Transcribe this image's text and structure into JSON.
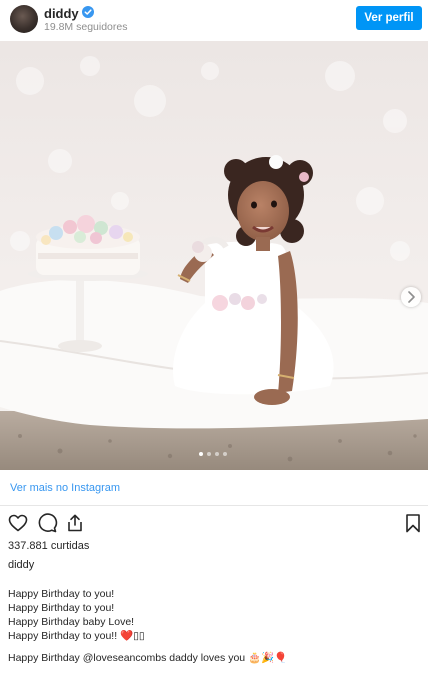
{
  "header": {
    "username": "diddy",
    "followers": "19.8M seguidores",
    "view_profile_label": "Ver perfil"
  },
  "carousel": {
    "slides": 4,
    "current": 1
  },
  "more_link": "Ver mais no Instagram",
  "likes": "337.881 curtidas",
  "caption": {
    "username": "diddy",
    "lines": [
      "Happy Birthday to you!",
      "Happy Birthday to you!",
      "Happy Birthday baby Love!",
      "Happy Birthday to you!! ❤️▯▯",
      "",
      "Happy Birthday @loveseancombs daddy loves you 🎂🎉🎈"
    ]
  },
  "icons": {
    "verified": "verified-badge-icon",
    "like": "heart-icon",
    "comment": "comment-icon",
    "share": "share-icon",
    "save": "bookmark-icon",
    "next": "chevron-right-icon"
  },
  "colors": {
    "accent": "#0095f6",
    "link": "#3897f0",
    "text": "#262626",
    "muted": "#8e8e8e"
  }
}
